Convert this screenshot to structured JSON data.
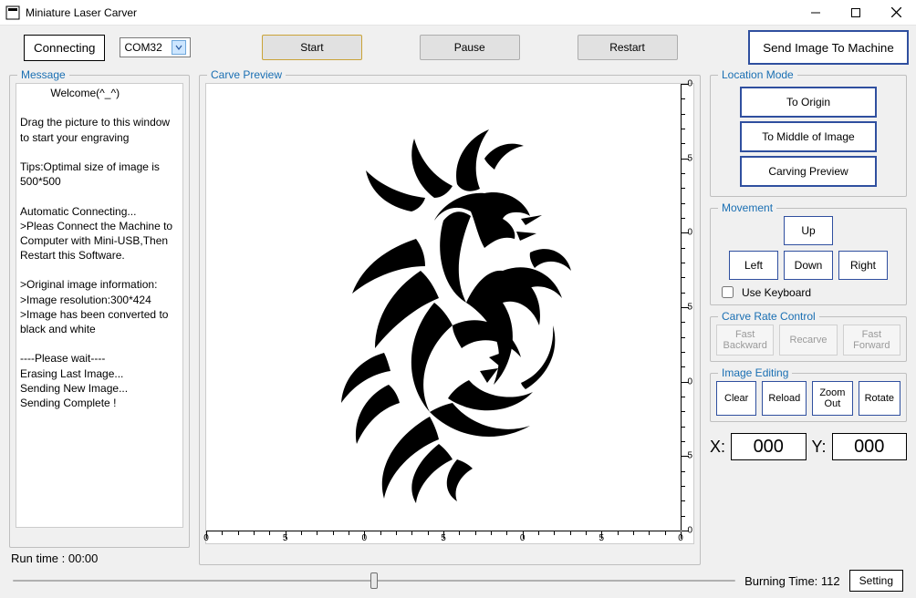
{
  "title": "Miniature Laser Carver",
  "toolbar": {
    "connecting": "Connecting",
    "com_port": "COM32",
    "start": "Start",
    "pause": "Pause",
    "restart": "Restart",
    "send_image": "Send Image To Machine"
  },
  "message_panel": {
    "title": "Message",
    "body": "          Welcome(^_^)\n\nDrag the picture to this window to start your engraving\n\nTips:Optimal size of image is 500*500\n\nAutomatic Connecting...\n>Pleas Connect the Machine to Computer with Mini-USB,Then Restart this Software.\n\n>Original image information:\n>Image resolution:300*424\n>Image has been converted to black and white\n\n----Please wait----\nErasing Last Image...\nSending New Image...\nSending Complete !",
    "runtime_label": "Run time :  00:00"
  },
  "preview": {
    "title": "Carve Preview",
    "ruler_marks": [
      "0",
      "5",
      "0",
      "5",
      "0",
      "5",
      "0"
    ],
    "image_description": "tribal dragon silhouette"
  },
  "location_mode": {
    "title": "Location Mode",
    "origin": "To Origin",
    "middle": "To Middle of Image",
    "preview": "Carving Preview"
  },
  "movement": {
    "title": "Movement",
    "up": "Up",
    "down": "Down",
    "left": "Left",
    "right": "Right",
    "use_keyboard": "Use Keyboard"
  },
  "carve_rate": {
    "title": "Carve Rate Control",
    "fast_backward": "Fast\nBackward",
    "recarve": "Recarve",
    "fast_forward": "Fast\nForward"
  },
  "image_editing": {
    "title": "Image Editing",
    "clear": "Clear",
    "reload": "Reload",
    "zoom_out": "Zoom\nOut",
    "rotate": "Rotate"
  },
  "coords": {
    "x_label": "X:",
    "y_label": "Y:",
    "x_value": "000",
    "y_value": "000"
  },
  "bottom": {
    "burning_time_label": "Burning Time:",
    "burning_time_value": "112",
    "setting": "Setting"
  }
}
